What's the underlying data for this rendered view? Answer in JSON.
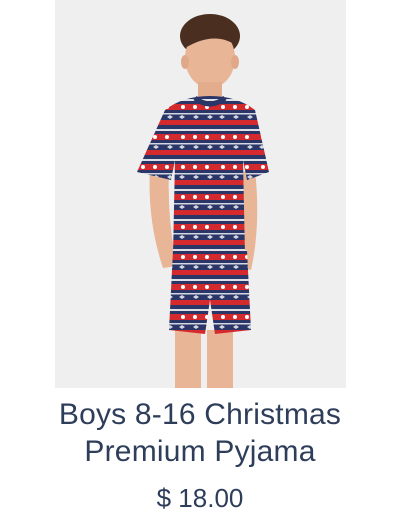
{
  "product": {
    "title_line1": "Boys 8-16 Christmas",
    "title_line2": "Premium Pyjama",
    "price": "$ 18.00"
  },
  "colors": {
    "text": "#2e3e5a",
    "photo_background": "#efefef",
    "pyjama_navy": "#2a3568",
    "pyjama_red": "#d42a2e"
  }
}
